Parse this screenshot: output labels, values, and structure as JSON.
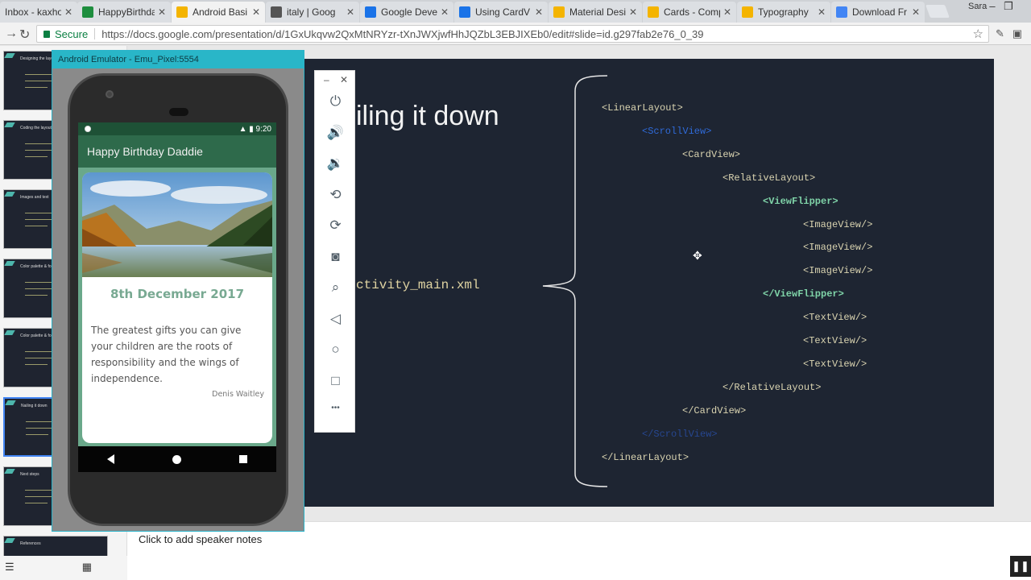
{
  "browser": {
    "tabs": [
      {
        "title": "Inbox - kaxho",
        "favicon_color": "#d93025",
        "active": false
      },
      {
        "title": "HappyBirthda",
        "favicon_color": "#1e8e3e",
        "active": false
      },
      {
        "title": "Android Basi",
        "favicon_color": "#f4b400",
        "active": true
      },
      {
        "title": "italy | Goog",
        "favicon_color": "#555555",
        "active": false
      },
      {
        "title": "Google Deve",
        "favicon_color": "#1a73e8",
        "active": false
      },
      {
        "title": "Using CardV",
        "favicon_color": "#1a73e8",
        "active": false
      },
      {
        "title": "Material Desi",
        "favicon_color": "#f4b400",
        "active": false
      },
      {
        "title": "Cards - Comp",
        "favicon_color": "#f4b400",
        "active": false
      },
      {
        "title": "Typography",
        "favicon_color": "#f4b400",
        "active": false
      },
      {
        "title": "Download Fr",
        "favicon_color": "#4285f4",
        "active": false
      }
    ],
    "profile_name": "Sara",
    "secure_label": "Secure",
    "url": "https://docs.google.com/presentation/d/1GxUkqvw2QxMtNRYzr-tXnJWXjwfHhJQZbL3EBJIXEb0/edit#slide=id.g297fab2e76_0_39"
  },
  "filmstrip": {
    "slides": [
      {
        "title": "Designing the layo"
      },
      {
        "title": "Coding the layout"
      },
      {
        "title": "Images and text"
      },
      {
        "title": "Color palette & fon"
      },
      {
        "title": "Color palette & fon"
      },
      {
        "title": "Nailing it down",
        "selected": true
      },
      {
        "title": "Next steps"
      },
      {
        "title": "References"
      }
    ]
  },
  "slide": {
    "title": "iling it down",
    "filename": "ctivity_main.xml",
    "code": [
      {
        "text": "<LinearLayout>",
        "style": "normal",
        "indent": 0
      },
      {
        "text": "<ScrollView>",
        "style": "blue",
        "indent": 1
      },
      {
        "text": "<CardView>",
        "style": "normal",
        "indent": 2
      },
      {
        "text": "<RelativeLayout>",
        "style": "normal",
        "indent": 3
      },
      {
        "text": "<ViewFlipper>",
        "style": "green",
        "indent": 4
      },
      {
        "text": "<ImageView/>",
        "style": "normal",
        "indent": 5
      },
      {
        "text": "<ImageView/>",
        "style": "normal",
        "indent": 5
      },
      {
        "text": "<ImageView/>",
        "style": "normal",
        "indent": 5
      },
      {
        "text": "</ViewFlipper>",
        "style": "green",
        "indent": 4
      },
      {
        "text": "<TextView/>",
        "style": "normal",
        "indent": 5
      },
      {
        "text": "<TextView/>",
        "style": "normal",
        "indent": 5
      },
      {
        "text": "<TextView/>",
        "style": "normal",
        "indent": 5
      },
      {
        "text": "</RelativeLayout>",
        "style": "normal",
        "indent": 3
      },
      {
        "text": "</CardView>",
        "style": "normal",
        "indent": 2
      },
      {
        "text": "</ScrollView>",
        "style": "dim",
        "indent": 1
      },
      {
        "text": "</LinearLayout>",
        "style": "normal",
        "indent": 0
      }
    ]
  },
  "notes": {
    "placeholder": "Click to add speaker notes"
  },
  "emulator": {
    "window_title": "Android Emulator - Emu_Pixel:5554",
    "status_time": "9:20",
    "app_title": "Happy Birthday Daddie",
    "card_date": "8th December 2017",
    "card_quote": "The greatest gifts you can give your children are the roots of responsibility and the wings of independence.",
    "card_author": "Denis Waitley",
    "tools": [
      {
        "name": "power-icon",
        "glyph": "⏻"
      },
      {
        "name": "volume-up-icon",
        "glyph": "🔊"
      },
      {
        "name": "volume-down-icon",
        "glyph": "🔉"
      },
      {
        "name": "rotate-left-icon",
        "glyph": "⟲"
      },
      {
        "name": "rotate-right-icon",
        "glyph": "⟳"
      },
      {
        "name": "camera-icon",
        "glyph": "◙"
      },
      {
        "name": "zoom-icon",
        "glyph": "⌕"
      },
      {
        "name": "back-icon",
        "glyph": "◁"
      },
      {
        "name": "home-icon",
        "glyph": "○"
      },
      {
        "name": "overview-icon",
        "glyph": "□"
      },
      {
        "name": "more-icon",
        "glyph": "•••"
      }
    ]
  }
}
